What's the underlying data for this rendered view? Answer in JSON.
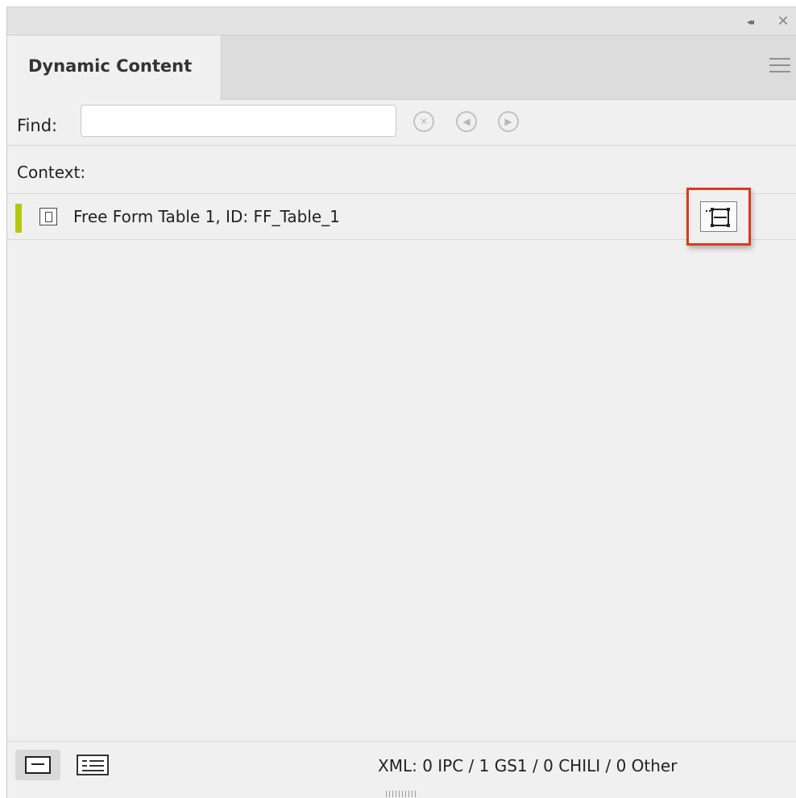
{
  "titlebar": {
    "collapse_glyph": "◂◂",
    "close_glyph": "✕"
  },
  "tab": {
    "label": "Dynamic Content"
  },
  "find": {
    "label": "Find:",
    "value": "",
    "placeholder": ""
  },
  "context": {
    "label": "Context:"
  },
  "items": [
    {
      "label": "Free Form Table 1, ID: FF_Table_1",
      "marker_color": "#b5c80f"
    }
  ],
  "status": {
    "counts": "XML: 0 IPC / 1 GS1 / 0 CHILI / 0 Other"
  },
  "colors": {
    "accent": "#b5c80f",
    "highlight": "#d93b1e"
  },
  "icons": {
    "collapse": "double-chevron-left-icon",
    "close": "close-icon",
    "menu": "hamburger-menu-icon",
    "clear": "clear-circle-icon",
    "previous": "previous-circle-icon",
    "next": "next-circle-icon",
    "table": "table-frame-icon",
    "edit": "edit-selection-icon"
  }
}
